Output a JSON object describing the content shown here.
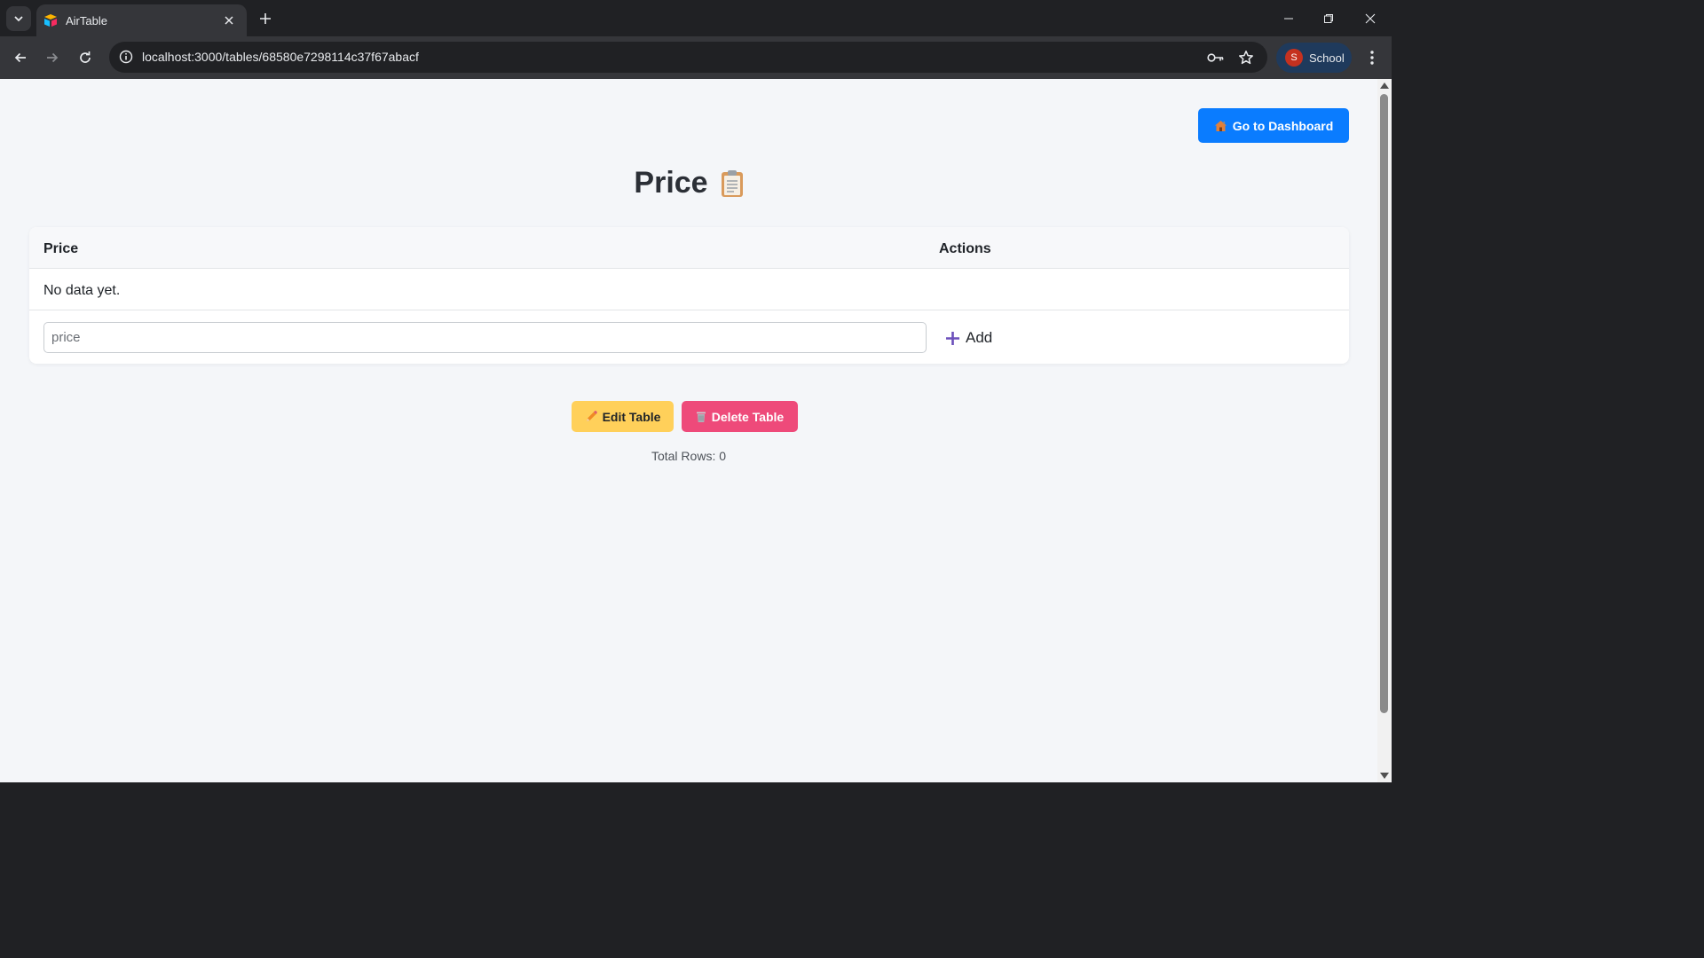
{
  "browser": {
    "tab_title": "AirTable",
    "url": "localhost:3000/tables/68580e7298114c37f67abacf",
    "profile_initial": "S",
    "profile_name": "School"
  },
  "page": {
    "dashboard_button": "Go to Dashboard",
    "title": "Price",
    "table": {
      "columns": [
        "Price",
        "Actions"
      ],
      "empty_message": "No data yet.",
      "input_placeholder": "price",
      "add_label": "Add"
    },
    "edit_button": "Edit Table",
    "delete_button": "Delete Table",
    "total_rows": "Total Rows: 0"
  },
  "colors": {
    "primary": "#0a7cff",
    "edit": "#ffd05a",
    "delete": "#ee4a7a",
    "background": "#f4f6f9"
  }
}
